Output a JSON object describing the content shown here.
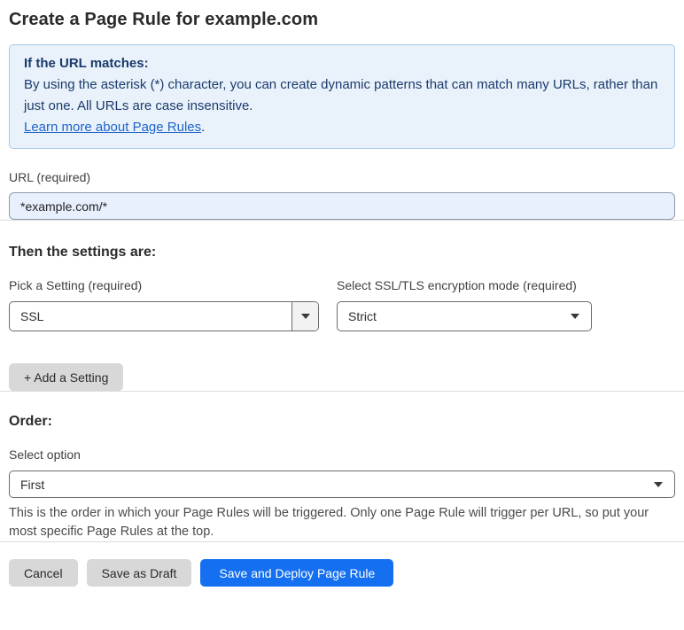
{
  "page": {
    "title": "Create a Page Rule for example.com"
  },
  "info_box": {
    "heading": "If the URL matches:",
    "body": "By using the asterisk (*) character, you can create dynamic patterns that can match many URLs, rather than just one. All URLs are case insensitive.",
    "link_label": "Learn more about Page Rules",
    "link_suffix": "."
  },
  "url_field": {
    "label": "URL (required)",
    "value": "*example.com/*"
  },
  "settings_section": {
    "heading": "Then the settings are:",
    "setting_picker": {
      "label": "Pick a Setting (required)",
      "value": "SSL"
    },
    "ssl_mode_picker": {
      "label": "Select SSL/TLS encryption mode (required)",
      "value": "Strict"
    },
    "add_setting_label": "+ Add a Setting"
  },
  "order_section": {
    "heading": "Order:",
    "select_label": "Select option",
    "value": "First",
    "help_text": "This is the order in which your Page Rules will be triggered. Only one Page Rule will trigger per URL, so put your most specific Page Rules at the top."
  },
  "footer": {
    "cancel_label": "Cancel",
    "save_draft_label": "Save as Draft",
    "save_deploy_label": "Save and Deploy Page Rule"
  },
  "colors": {
    "info_box_bg": "#e9f2fb",
    "info_box_border": "#a6c8e7",
    "info_text": "#1b3a6b",
    "link_blue": "#1e64c8",
    "url_input_bg": "#e8f0fe",
    "primary_button_blue": "#1470f0",
    "secondary_button_gray": "#d8d8d8"
  }
}
